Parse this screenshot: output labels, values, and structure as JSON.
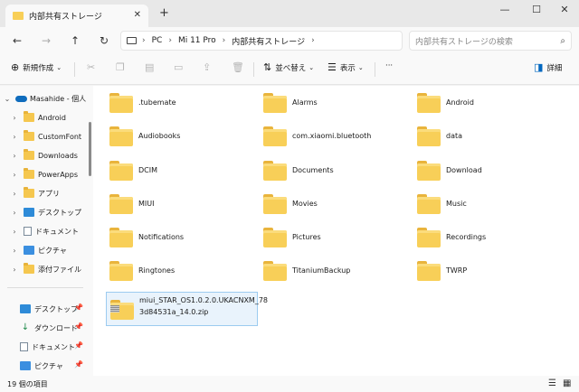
{
  "window": {
    "tab_title": "内部共有ストレージ",
    "tab_close": "✕",
    "new_tab": "+",
    "minimize": "—",
    "maximize": "☐",
    "close": "✕"
  },
  "nav": {
    "back": "←",
    "forward": "→",
    "up": "↑",
    "refresh": "↻",
    "breadcrumbs": [
      "PC",
      "Mi 11 Pro",
      "内部共有ストレージ"
    ],
    "search_placeholder": "内部共有ストレージの検索"
  },
  "commands": {
    "new_label": "新規作成",
    "sort_label": "並べ替え",
    "view_label": "表示",
    "more": "···",
    "details_label": "詳細"
  },
  "sidebar": {
    "root": "Masahide - 個人",
    "items": [
      {
        "label": "Android"
      },
      {
        "label": "CustomFont"
      },
      {
        "label": "Downloads"
      },
      {
        "label": "PowerApps"
      },
      {
        "label": "アプリ"
      },
      {
        "label": "デスクトップ"
      },
      {
        "label": "ドキュメント"
      },
      {
        "label": "ピクチャ"
      },
      {
        "label": "添付ファイル"
      }
    ],
    "quick": [
      {
        "label": "デスクトップ"
      },
      {
        "label": "ダウンロード"
      },
      {
        "label": "ドキュメント"
      },
      {
        "label": "ピクチャ"
      }
    ]
  },
  "files": {
    "folders": [
      ".tubemate",
      "Alarms",
      "Android",
      "Audiobooks",
      "com.xiaomi.bluetooth",
      "data",
      "DCIM",
      "Documents",
      "Download",
      "MIUI",
      "Movies",
      "Music",
      "Notifications",
      "Pictures",
      "Recordings",
      "Ringtones",
      "TitaniumBackup",
      "TWRP"
    ],
    "zip_line1": "miui_STAR_OS1.0.2.0.UKACNXM_78",
    "zip_line2": "3d84531a_14.0.zip"
  },
  "status": {
    "count_text": "19 個の項目"
  },
  "colors": {
    "folder": "#f8cf58",
    "selection": "#e9f3fc",
    "accent": "#0067c0"
  }
}
